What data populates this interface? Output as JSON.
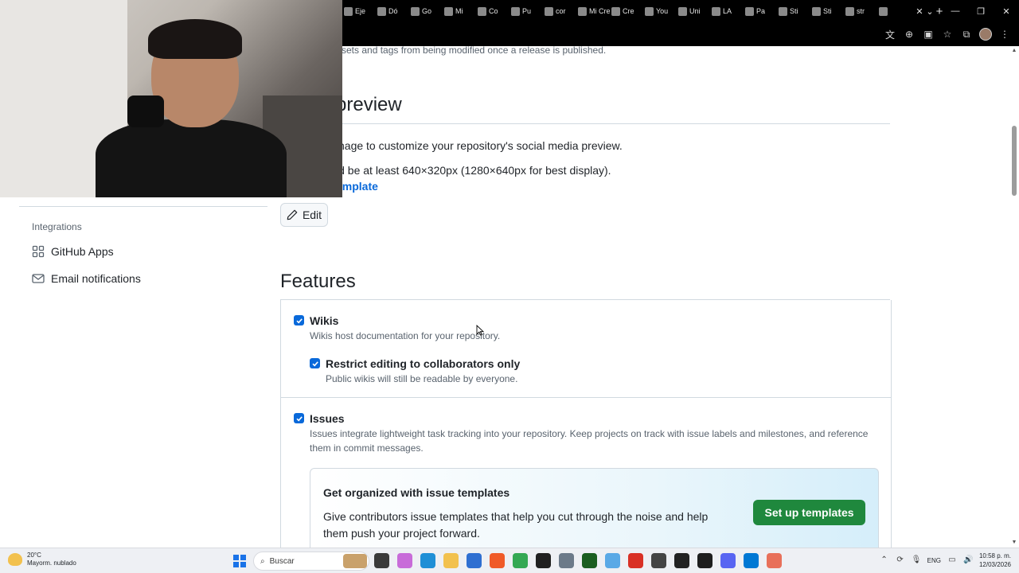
{
  "browser": {
    "tabs": [
      "Eje",
      "Dó",
      "Go",
      "Mi",
      "Co",
      "Pu",
      "cor",
      "Mi Cre",
      "Cre",
      "You",
      "Uni",
      "LA",
      "Pa",
      "Sti",
      "Sti",
      "str"
    ],
    "tab_close": "✕",
    "new_tab": "+"
  },
  "sidebar": {
    "section_heading": "Integrations",
    "items": [
      {
        "label": "GitHub Apps"
      },
      {
        "label": "Email notifications"
      }
    ]
  },
  "main": {
    "top_snippet": "sets and tags from being modified once a release is published.",
    "social_preview": {
      "heading_partial": "preview",
      "line1": "nage to customize your repository's social media preview.",
      "line2": "ld be at least 640×320px (1280×640px for best display).",
      "link": "emplate",
      "edit_label": "Edit"
    },
    "features": {
      "title": "Features",
      "wikis": {
        "label": "Wikis",
        "description": "Wikis host documentation for your repository.",
        "restrict_label": "Restrict editing to collaborators only",
        "restrict_description": "Public wikis will still be readable by everyone."
      },
      "issues": {
        "label": "Issues",
        "description": "Issues integrate lightweight task tracking into your repository. Keep projects on track with issue labels and milestones, and reference them in commit messages."
      },
      "promo": {
        "title": "Get organized with issue templates",
        "text": "Give contributors issue templates that help you cut through the noise and help them push your project forward.",
        "button": "Set up templates"
      }
    }
  },
  "taskbar": {
    "weather_temp": "20°C",
    "weather_desc": "Mayorm. nublado",
    "search_placeholder": "Buscar",
    "language": "ENG",
    "time": "10:58 p. m.",
    "date": "12/03/2026"
  },
  "colors": {
    "accent": "#0969da",
    "button_green": "#1f883d",
    "border": "#d1d9e0",
    "muted_text": "#59636e"
  }
}
